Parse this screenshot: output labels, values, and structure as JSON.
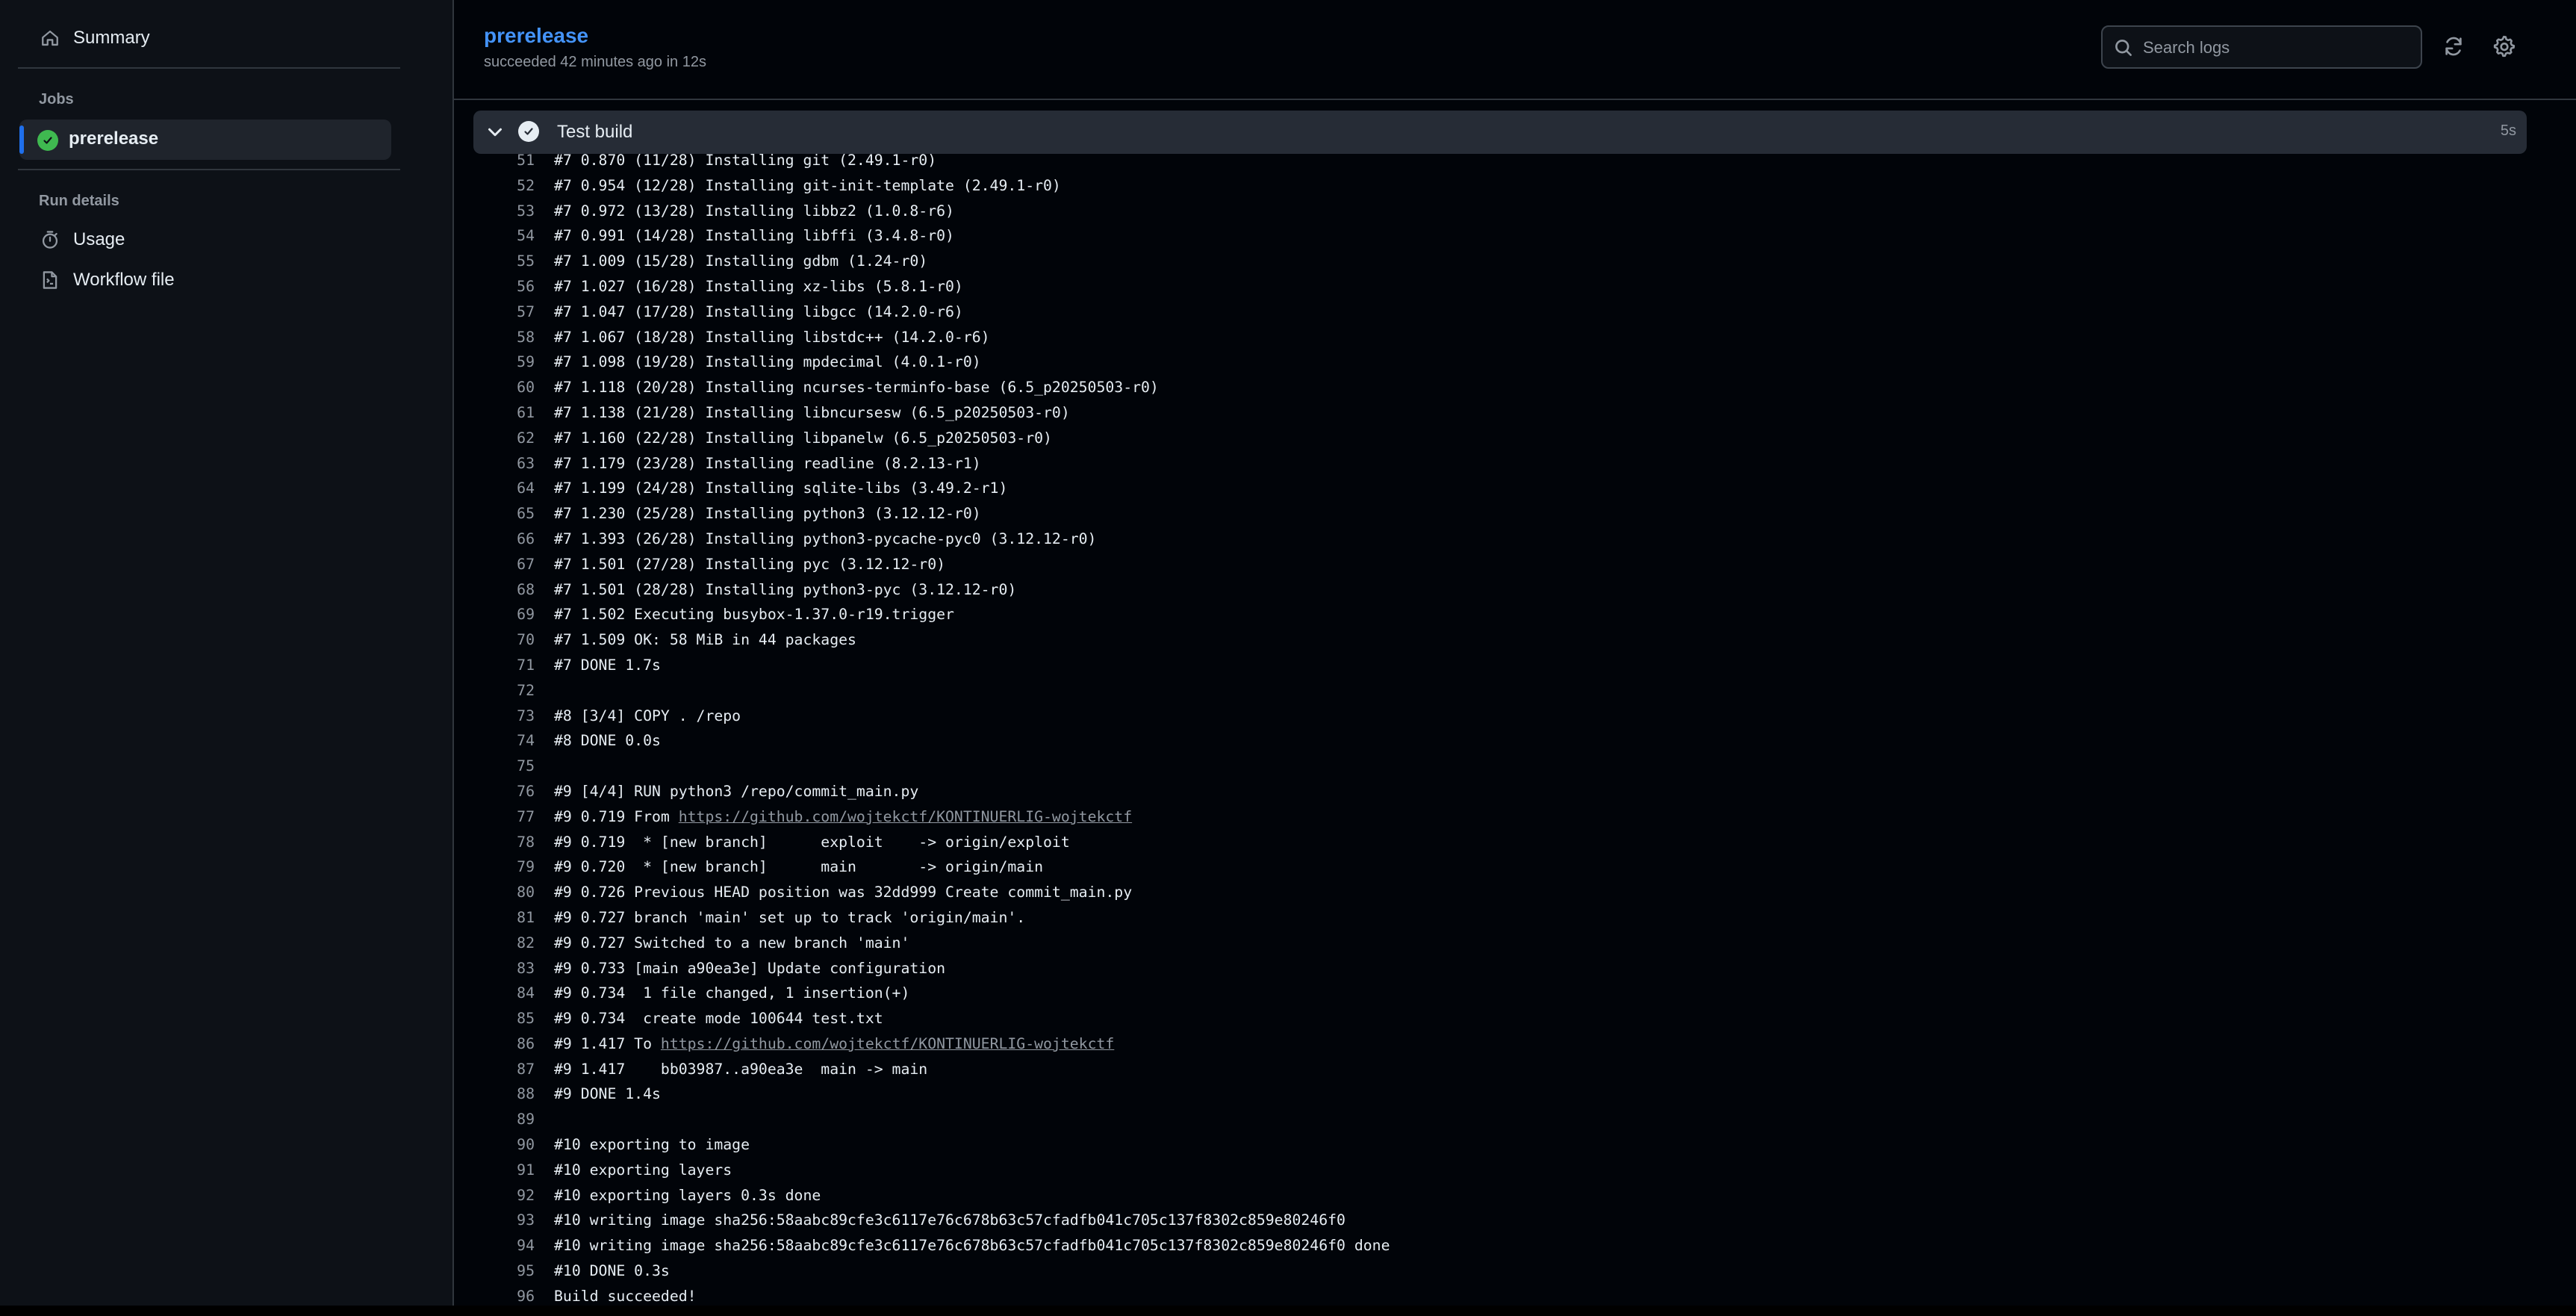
{
  "sidebar": {
    "summary_label": "Summary",
    "jobs_heading": "Jobs",
    "job_name": "prerelease",
    "run_details_heading": "Run details",
    "usage_label": "Usage",
    "workflow_file_label": "Workflow file"
  },
  "header": {
    "run_title": "prerelease",
    "run_subtitle": "succeeded 42 minutes ago in 12s",
    "search_placeholder": "Search logs"
  },
  "step": {
    "title": "Test build",
    "duration": "5s",
    "status": "success"
  },
  "log": [
    {
      "n": "51",
      "t": "#7 0.870 (11/28) Installing git (2.49.1-r0)"
    },
    {
      "n": "52",
      "t": "#7 0.954 (12/28) Installing git-init-template (2.49.1-r0)"
    },
    {
      "n": "53",
      "t": "#7 0.972 (13/28) Installing libbz2 (1.0.8-r6)"
    },
    {
      "n": "54",
      "t": "#7 0.991 (14/28) Installing libffi (3.4.8-r0)"
    },
    {
      "n": "55",
      "t": "#7 1.009 (15/28) Installing gdbm (1.24-r0)"
    },
    {
      "n": "56",
      "t": "#7 1.027 (16/28) Installing xz-libs (5.8.1-r0)"
    },
    {
      "n": "57",
      "t": "#7 1.047 (17/28) Installing libgcc (14.2.0-r6)"
    },
    {
      "n": "58",
      "t": "#7 1.067 (18/28) Installing libstdc++ (14.2.0-r6)"
    },
    {
      "n": "59",
      "t": "#7 1.098 (19/28) Installing mpdecimal (4.0.1-r0)"
    },
    {
      "n": "60",
      "t": "#7 1.118 (20/28) Installing ncurses-terminfo-base (6.5_p20250503-r0)"
    },
    {
      "n": "61",
      "t": "#7 1.138 (21/28) Installing libncursesw (6.5_p20250503-r0)"
    },
    {
      "n": "62",
      "t": "#7 1.160 (22/28) Installing libpanelw (6.5_p20250503-r0)"
    },
    {
      "n": "63",
      "t": "#7 1.179 (23/28) Installing readline (8.2.13-r1)"
    },
    {
      "n": "64",
      "t": "#7 1.199 (24/28) Installing sqlite-libs (3.49.2-r1)"
    },
    {
      "n": "65",
      "t": "#7 1.230 (25/28) Installing python3 (3.12.12-r0)"
    },
    {
      "n": "66",
      "t": "#7 1.393 (26/28) Installing python3-pycache-pyc0 (3.12.12-r0)"
    },
    {
      "n": "67",
      "t": "#7 1.501 (27/28) Installing pyc (3.12.12-r0)"
    },
    {
      "n": "68",
      "t": "#7 1.501 (28/28) Installing python3-pyc (3.12.12-r0)"
    },
    {
      "n": "69",
      "t": "#7 1.502 Executing busybox-1.37.0-r19.trigger"
    },
    {
      "n": "70",
      "t": "#7 1.509 OK: 58 MiB in 44 packages"
    },
    {
      "n": "71",
      "t": "#7 DONE 1.7s"
    },
    {
      "n": "72",
      "t": ""
    },
    {
      "n": "73",
      "t": "#8 [3/4] COPY . /repo"
    },
    {
      "n": "74",
      "t": "#8 DONE 0.0s"
    },
    {
      "n": "75",
      "t": ""
    },
    {
      "n": "76",
      "t": "#9 [4/4] RUN python3 /repo/commit_main.py"
    },
    {
      "n": "77",
      "t": "#9 0.719 From ",
      "link": "https://github.com/wojtekctf/KONTINUERLIG-wojtekctf"
    },
    {
      "n": "78",
      "t": "#9 0.719  * [new branch]      exploit    -> origin/exploit"
    },
    {
      "n": "79",
      "t": "#9 0.720  * [new branch]      main       -> origin/main"
    },
    {
      "n": "80",
      "t": "#9 0.726 Previous HEAD position was 32dd999 Create commit_main.py"
    },
    {
      "n": "81",
      "t": "#9 0.727 branch 'main' set up to track 'origin/main'."
    },
    {
      "n": "82",
      "t": "#9 0.727 Switched to a new branch 'main'"
    },
    {
      "n": "83",
      "t": "#9 0.733 [main a90ea3e] Update configuration"
    },
    {
      "n": "84",
      "t": "#9 0.734  1 file changed, 1 insertion(+)"
    },
    {
      "n": "85",
      "t": "#9 0.734  create mode 100644 test.txt"
    },
    {
      "n": "86",
      "t": "#9 1.417 To ",
      "link": "https://github.com/wojtekctf/KONTINUERLIG-wojtekctf"
    },
    {
      "n": "87",
      "t": "#9 1.417    bb03987..a90ea3e  main -> main"
    },
    {
      "n": "88",
      "t": "#9 DONE 1.4s"
    },
    {
      "n": "89",
      "t": ""
    },
    {
      "n": "90",
      "t": "#10 exporting to image"
    },
    {
      "n": "91",
      "t": "#10 exporting layers"
    },
    {
      "n": "92",
      "t": "#10 exporting layers 0.3s done"
    },
    {
      "n": "93",
      "t": "#10 writing image sha256:58aabc89cfe3c6117e76c678b63c57cfadfb041c705c137f8302c859e80246f0"
    },
    {
      "n": "94",
      "t": "#10 writing image sha256:58aabc89cfe3c6117e76c678b63c57cfadfb041c705c137f8302c859e80246f0 done"
    },
    {
      "n": "95",
      "t": "#10 DONE 0.3s"
    },
    {
      "n": "96",
      "t": "Build succeeded!"
    }
  ]
}
